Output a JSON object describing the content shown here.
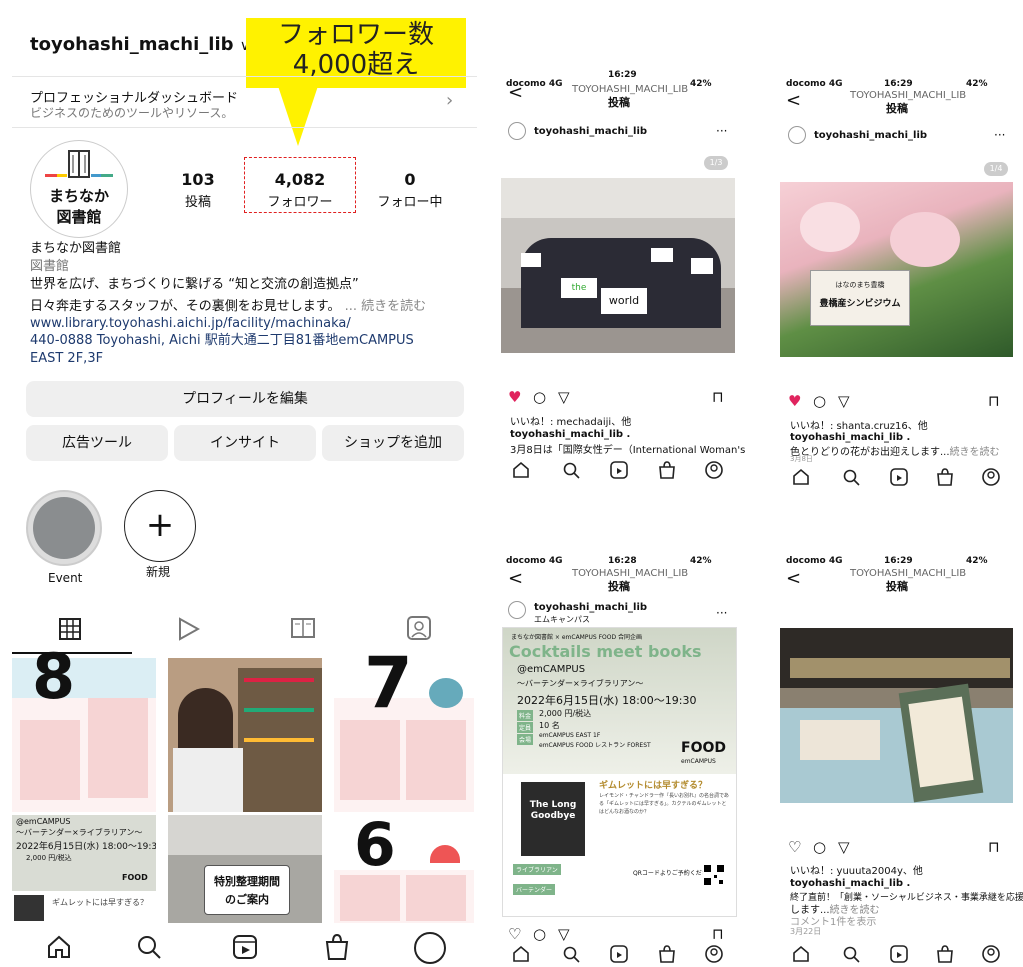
{
  "profile": {
    "username": "toyohashi_machi_lib",
    "username_chevron": "∨",
    "callout": "フォロワー数\n4,000超え",
    "dashboard_title": "プロフェッショナルダッシュボード",
    "dashboard_sub": "ビジネスのためのツールやリソース。",
    "avatar_line1": "まちなか",
    "avatar_line2": "図書館",
    "posts_count": "103",
    "posts_label": "投稿",
    "followers_count": "4,082",
    "followers_label": "フォロワー",
    "following_count": "0",
    "following_label": "フォロー中",
    "name": "まちなか図書館",
    "category": "図書館",
    "bio1": "世界を広げ、まちづくりに繋げる “知と交流の創造拠点”",
    "bio2": "日々奔走するスタッフが、その裏側をお見せします。",
    "bio_more": "... 続きを読む",
    "link": "www.library.toyohashi.aichi.jp/facility/machinaka/",
    "address": "440-0888 Toyohashi, Aichi 駅前大通二丁目81番地emCAMPUS EAST 2F,3F",
    "edit_button": "プロフィールを編集",
    "ads_button": "広告ツール",
    "insight_button": "インサイト",
    "shop_button": "ショップを追加",
    "highlight1": "Event",
    "highlight2": "新規",
    "new_plus": "+"
  },
  "grid": {
    "cell1_num": "8",
    "cell3_num": "7",
    "cell4_campus": "@emCAMPUS",
    "cell4_sub": "～バーテンダー×ライブラリアン～",
    "cell4_date": "2022年6月15日(水) 18:00～19:30",
    "cell4_extra": "2,000 円/税込",
    "cell4_food": "FOOD",
    "cell4_bottom": "ギムレットには早すぎる？",
    "cell5_line1": "特別整理期間",
    "cell5_line2": "のご案内",
    "cell6_num": "6"
  },
  "phones": {
    "carrier": "docomo  4G",
    "battery": "42%",
    "account_caps": "TOYOHASHI_MACHI_LIB",
    "posts_title": "投稿",
    "user": "toyohashi_machi_lib",
    "more": "···",
    "back": "<",
    "p1": {
      "time": "16:29",
      "counter": "1/3",
      "likes": "いいね！: mechadaiji、他",
      "caption_user": "toyohashi_machi_lib .",
      "caption": "3月8日は「国際女性デー（International Woman's",
      "sign1": "the",
      "sign2": "world"
    },
    "p2": {
      "time": "16:29",
      "counter": "1/4",
      "likes": "いいね！: shanta.cruz16、他",
      "caption_user": "toyohashi_machi_lib .",
      "caption": "色とりどりの花がお出迎えします...",
      "more": "続きを読む",
      "date": "3月8日",
      "card_top": "はなのまち豊橋",
      "card_main": "豊橋産シンビジウム"
    },
    "p3": {
      "time": "16:28",
      "location": "エムキャンパス",
      "head": "まちなか図書館 × emCAMPUS FOOD 合同企画",
      "title": "Cocktails meet books",
      "campus": "@emCAMPUS",
      "sub": "～バーテンダー×ライブラリアン～",
      "date": "2022年6月15日(水) 18:00～19:30",
      "fee_label": "料金",
      "fee": "2,000 円/税込",
      "cap_label": "定員",
      "cap": "10 名",
      "venue_label": "会場",
      "venue1": "emCAMPUS EAST 1F",
      "venue2": "emCAMPUS FOOD レストラン FOREST",
      "food": "FOOD",
      "emcampus": "emCAMPUS",
      "book": "The Long Goodbye",
      "q_title": "ギムレットには早すぎる？",
      "q_body": "レイモンド・チャンドラー作『長いお別れ』の名台詞である「ギムレットには早すぎる」。カクテルのギムレットとはどんなお酒なのか？",
      "lib_label": "ライブラリアン",
      "bar_label": "バーテンダー",
      "qr_note": "QRコードよりご予約ください"
    },
    "p4": {
      "time": "16:29",
      "likes": "いいね！: yuuuta2004y、他",
      "caption_user": "toyohashi_machi_lib .",
      "caption1": "終了直前！「創業・ソーシャルビジネス・事業承継を応援",
      "caption2": "します...",
      "more": "続きを読む",
      "comments": "コメント1件を表示",
      "date": "3月22日"
    }
  },
  "colors": {
    "callout": "#fff200",
    "dashbox": "#e02020",
    "link": "#1e3a6e",
    "like": "#e0245e",
    "cocktail_green": "#7fb48a",
    "dark": "#2b2b2b"
  },
  "icons": {
    "home": "⌂",
    "search": "🔍",
    "reels": "▶",
    "shop": "🛍",
    "heart": "♥",
    "heart_outline": "♡",
    "comment": "○",
    "share": "▽",
    "save": "⊓",
    "grid": "▦",
    "play": "▷",
    "guide": "📖",
    "tagged": "👤"
  }
}
